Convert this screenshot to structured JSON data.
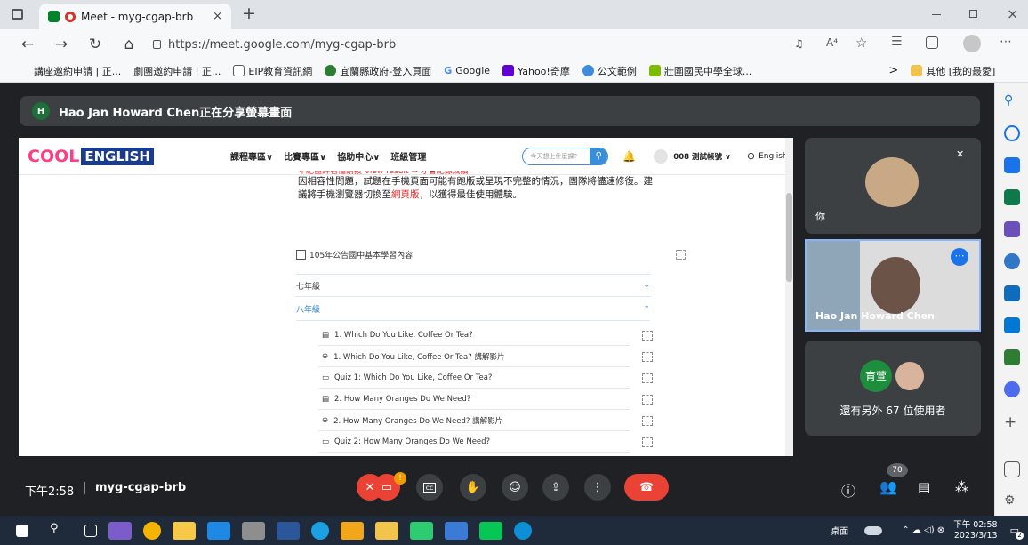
{
  "browser": {
    "tab_title": "Meet - myg-cgap-brb",
    "url": "https://meet.google.com/myg-cgap-brb",
    "new_tab": "+",
    "reader": "A⁴"
  },
  "bookmarks": [
    {
      "label": "講座邀約申請 | 正...",
      "color": "#c9c9c9"
    },
    {
      "label": "劇團邀約申請 | 正...",
      "color": "#c9c9c9"
    },
    {
      "label": "EIP教育資訊網",
      "color": "#777"
    },
    {
      "label": "宜蘭縣政府-登入頁面",
      "color": "#2d7d32"
    },
    {
      "label": "Google",
      "color": "#4285f4"
    },
    {
      "label": "Yahoo!奇摩",
      "color": "#6001d2"
    },
    {
      "label": "公文範例",
      "color": "#3c8dde"
    },
    {
      "label": "壯圍國民中學全球...",
      "color": "#7cbb00"
    }
  ],
  "bookmarks_other": "其他 [我的最愛]",
  "meet": {
    "sharer_initial": "H",
    "sharer_text": "Hao Jan Howard Chen正在分享螢幕畫面",
    "time": "下午2:58",
    "code": "myg-cgap-brb",
    "you_label": "你",
    "hao_name": "Hao Jan Howard Chen",
    "others_badge": "育萱",
    "others_text": "還有另外 67 位使用者",
    "participants_count": "70",
    "mic_notice": "!"
  },
  "cool": {
    "logo_a": "COOL",
    "logo_b": "ENGLISH",
    "nav": [
      "課程專區∨",
      "比賽專區∨",
      "協助中心∨",
      "班級管理"
    ],
    "search_placeholder": "今天想上什麼課?",
    "account": "008 測試帳號 ∨",
    "lang": "English",
    "cut_line": "年紀體評看懂請按 View result → 才會紀錄成績!",
    "notice_a": "因相容性問題，試題在手機頁面可能有跑版或呈現不完整的情況，團隊將儘速修復。建議將手機瀏覽器切換至",
    "notice_red": "網頁版",
    "notice_b": "，以獲得最佳使用體驗。",
    "section": "105年公告國中基本學習內容",
    "grade7": "七年級",
    "grade8": "八年級",
    "items": [
      "1. Which Do You Like, Coffee Or Tea?",
      "1. Which Do You Like, Coffee Or Tea? 講解影片",
      "Quiz 1: Which Do You Like, Coffee Or Tea?",
      "2. How Many Oranges Do We Need?",
      "2. How Many Oranges Do We Need? 講解影片",
      "Quiz 2: How Many Oranges Do We Need?"
    ]
  },
  "taskbar": {
    "desktop": "桌面",
    "time": "下午 02:58",
    "date": "2023/3/13",
    "notif": "2"
  }
}
